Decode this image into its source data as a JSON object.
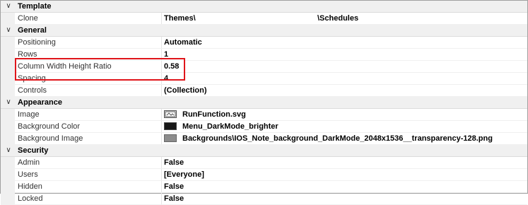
{
  "categories": {
    "template": {
      "label": "Template"
    },
    "general": {
      "label": "General"
    },
    "appearance": {
      "label": "Appearance"
    },
    "security": {
      "label": "Security"
    }
  },
  "rows": {
    "clone": {
      "name": "Clone",
      "value": "Themes\\",
      "value2": "\\Schedules"
    },
    "positioning": {
      "name": "Positioning",
      "value": "Automatic"
    },
    "rows": {
      "name": "Rows",
      "value": "1"
    },
    "column_ratio": {
      "name": "Column Width Height Ratio",
      "value": "0.58"
    },
    "spacing": {
      "name": "Spacing",
      "value": "4"
    },
    "controls": {
      "name": "Controls",
      "value": "(Collection)"
    },
    "image": {
      "name": "Image",
      "value": "RunFunction.svg",
      "icon": "image-file-icon"
    },
    "background_color": {
      "name": "Background Color",
      "value": "Menu_DarkMode_brighter",
      "color": "#161616"
    },
    "background_image": {
      "name": "Background Image",
      "value": "Backgrounds\\IOS_Note_background_DarkMode_2048x1536__transparency-128.png",
      "color": "#8c8c8c"
    },
    "admin": {
      "name": "Admin",
      "value": "False"
    },
    "users": {
      "name": "Users",
      "value": "[Everyone]"
    },
    "hidden": {
      "name": "Hidden",
      "value": "False"
    },
    "locked": {
      "name": "Locked",
      "value": "False"
    }
  },
  "colors": {
    "highlight_border": "#e0161b",
    "category_bg": "#f0f0f0"
  }
}
